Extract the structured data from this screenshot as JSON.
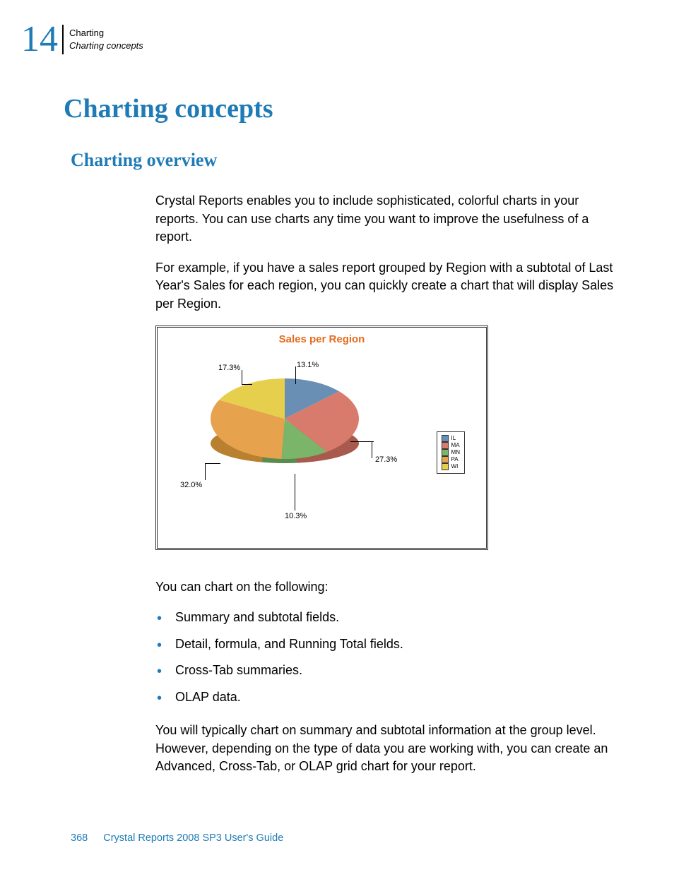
{
  "header": {
    "chapter_number": "14",
    "line1": "Charting",
    "line2": "Charting concepts"
  },
  "title": "Charting concepts",
  "subtitle": "Charting overview",
  "paragraphs": {
    "p1": "Crystal Reports enables you to include sophisticated, colorful charts in your reports. You can use charts any time you want to improve the usefulness of a report.",
    "p2": "For example, if you have a sales report grouped by Region with a subtotal of Last Year's Sales for each region, you can quickly create a chart that will display Sales per Region.",
    "p3": "You can chart on the following:",
    "p4": "You will typically chart on summary and subtotal information at the group level. However, depending on the type of data you are working with, you can create an Advanced, Cross-Tab, or OLAP grid chart for your report."
  },
  "bullets": [
    "Summary and subtotal fields.",
    "Detail, formula, and Running Total fields.",
    "Cross-Tab summaries.",
    "OLAP data."
  ],
  "chart_data": {
    "type": "pie",
    "title": "Sales per Region",
    "series": [
      {
        "name": "IL",
        "value": 13.1,
        "label": "13.1%",
        "color": "#6a8fb5"
      },
      {
        "name": "MA",
        "value": 27.3,
        "label": "27.3%",
        "color": "#d97b6c"
      },
      {
        "name": "MN",
        "value": 10.3,
        "label": "10.3%",
        "color": "#7bb56a"
      },
      {
        "name": "PA",
        "value": 32.0,
        "label": "32.0%",
        "color": "#e6a24d"
      },
      {
        "name": "WI",
        "value": 17.3,
        "label": "17.3%",
        "color": "#e6cf4d"
      }
    ],
    "legend_position": "right"
  },
  "footer": {
    "page_number": "368",
    "doc_title": "Crystal Reports 2008 SP3 User's Guide"
  }
}
